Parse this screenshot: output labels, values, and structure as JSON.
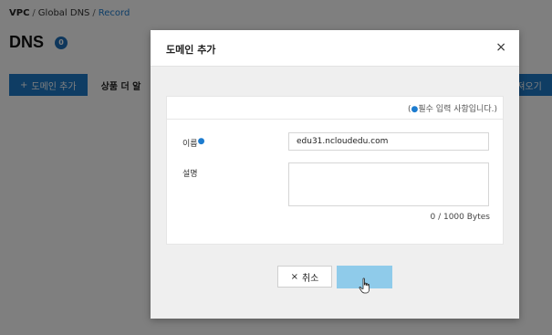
{
  "breadcrumb": {
    "root": "VPC",
    "sep1": "/",
    "middle": "Global DNS",
    "sep2": "/",
    "current": "Record"
  },
  "page": {
    "title": "DNS",
    "count": "0"
  },
  "toolbar": {
    "add_icon": "+",
    "add_label": "도메인 추가",
    "more_label": "상품 더 알",
    "import_label": "가져오기"
  },
  "modal": {
    "title": "도메인 추가",
    "close_icon": "×",
    "required_note_prefix": "(",
    "required_note_dot": "●",
    "required_note_text": "필수 입력 사항입니다.)",
    "name_label": "이름",
    "name_required": "●",
    "name_value": "edu31.ncloudedu.com",
    "desc_label": "설명",
    "desc_value": "",
    "byte_counter": "0 / 1000 Bytes",
    "cancel_icon": "×",
    "cancel_label": "취소",
    "confirm_label": ""
  },
  "colors": {
    "accent": "#1f7bc8",
    "confirm_button": "#8fcbea",
    "required_dot": "#1d7ccf"
  },
  "icons": {
    "close": "close-icon",
    "cancel": "x-icon",
    "add": "plus-icon",
    "pointer": "hand-cursor-icon"
  }
}
